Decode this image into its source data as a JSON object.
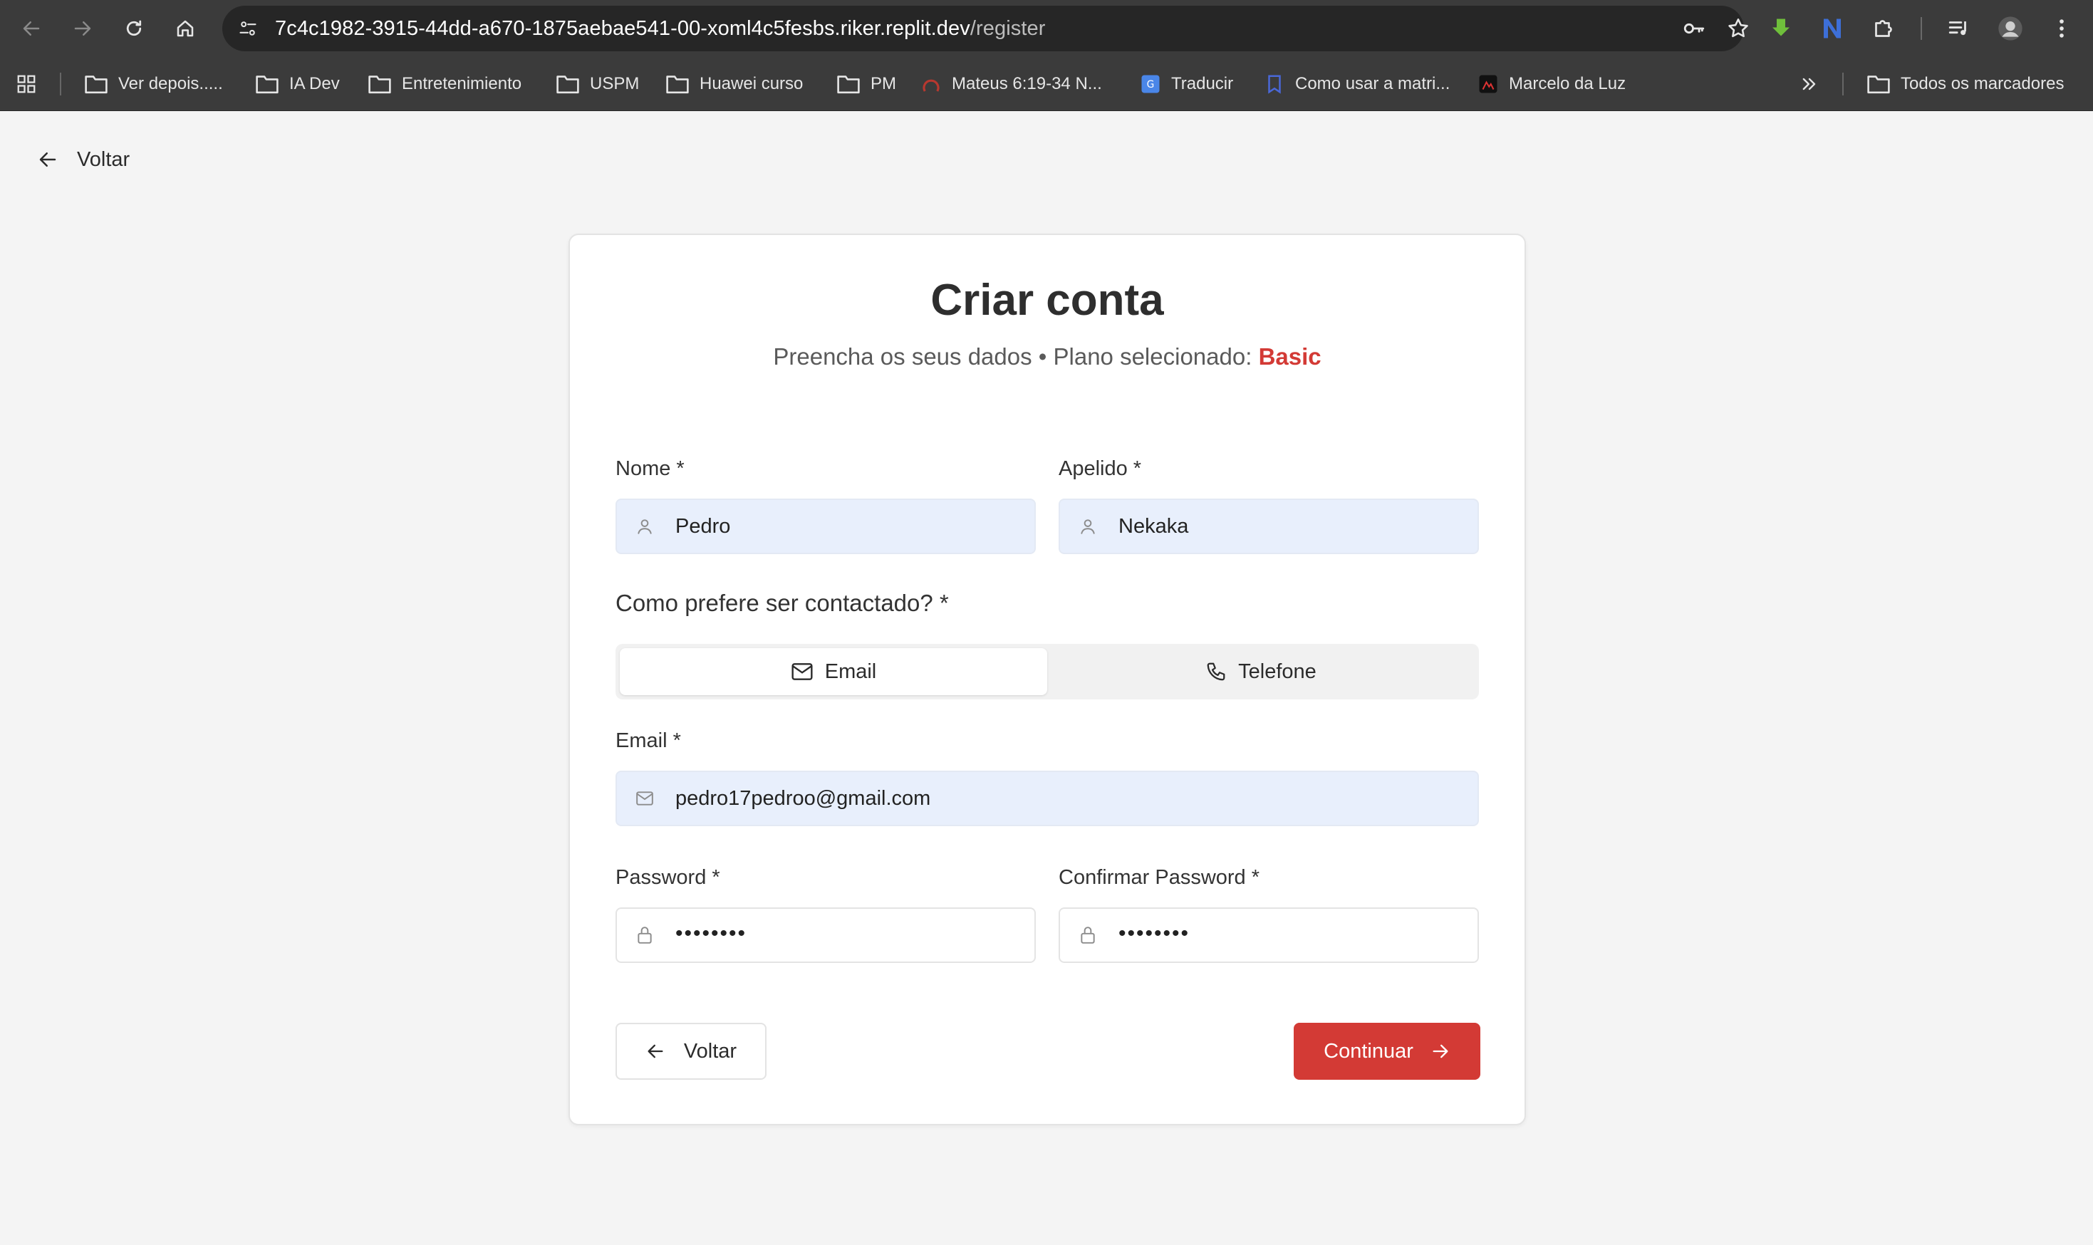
{
  "browser": {
    "url_host": "7c4c1982-3915-44dd-a670-1875aebae541-00-xoml4c5fesbs.riker.replit.dev",
    "url_path": "/register",
    "bookmarks": [
      {
        "label": "Ver depois.....",
        "icon": "folder-icon"
      },
      {
        "label": "IA Dev",
        "icon": "folder-icon"
      },
      {
        "label": "Entretenimiento",
        "icon": "folder-icon"
      },
      {
        "label": "USPM",
        "icon": "folder-icon"
      },
      {
        "label": "Huawei curso",
        "icon": "folder-icon"
      },
      {
        "label": "PM",
        "icon": "folder-icon"
      },
      {
        "label": "Mateus 6:19-34 N...",
        "icon": "site-icon"
      },
      {
        "label": "Traducir",
        "icon": "translate-icon"
      },
      {
        "label": "Como usar a matri...",
        "icon": "site-icon"
      },
      {
        "label": "Marcelo da Luz",
        "icon": "site-icon"
      }
    ],
    "all_bookmarks_label": "Todos os marcadores"
  },
  "page": {
    "back_label": "Voltar",
    "title": "Criar conta",
    "subtitle_prefix": "Preencha os seus dados • Plano selecionado: ",
    "plan_name": "Basic",
    "first_name": {
      "label": "Nome *",
      "value": "Pedro"
    },
    "last_name": {
      "label": "Apelido *",
      "value": "Nekaka"
    },
    "contact_question": "Como prefere ser contactado? *",
    "contact_options": [
      {
        "label": "Email",
        "icon": "mail-icon",
        "selected": true
      },
      {
        "label": "Telefone",
        "icon": "phone-icon",
        "selected": false
      }
    ],
    "email": {
      "label": "Email *",
      "value": "pedro17pedroo@gmail.com"
    },
    "password": {
      "label": "Password *",
      "value": "••••••••"
    },
    "confirm_password": {
      "label": "Confirmar Password *",
      "value": "••••••••"
    },
    "back_button": "Voltar",
    "continue_button": "Continuar"
  },
  "colors": {
    "accent": "#d33a35",
    "input_filled_bg": "#e8effc",
    "page_bg": "#f4f4f4",
    "chrome_bg": "#3b3b3b"
  }
}
